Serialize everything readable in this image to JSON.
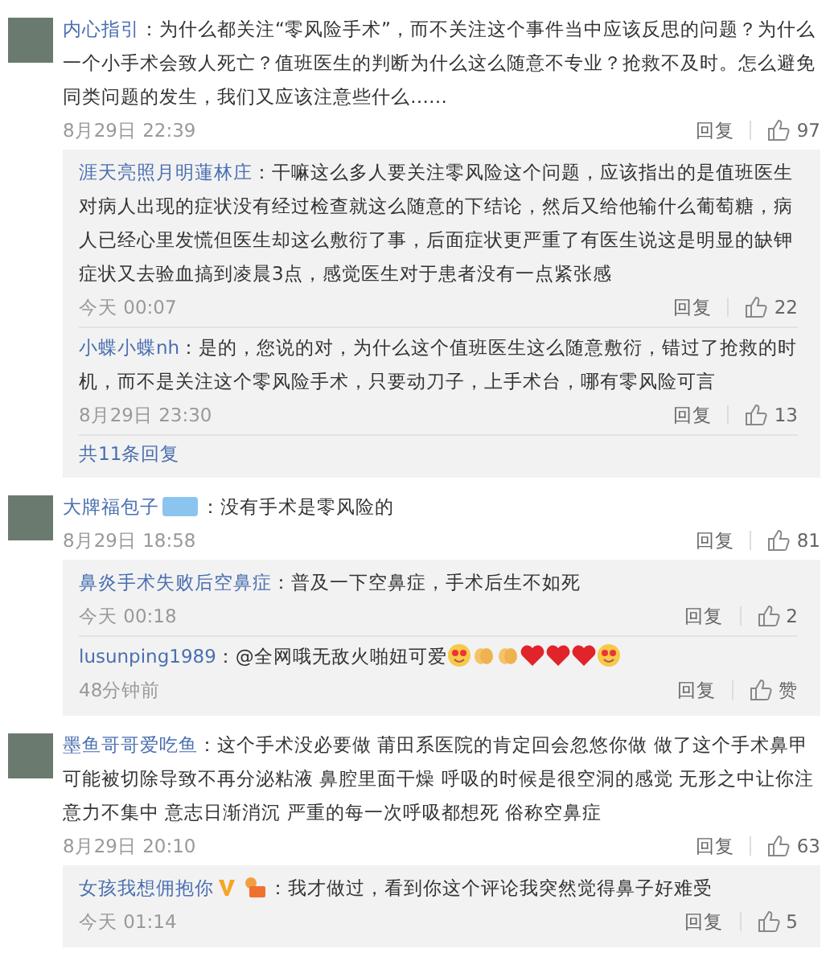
{
  "comments": [
    {
      "user": "内心指引",
      "text": "：为什么都关注“零风险手术”，而不关注这个事件当中应该反思的问题？为什么一个小手术会致人死亡？值班医生的判断为什么这么随意不专业？抢救不及时。怎么避免同类问题的发生，我们又应该注意些什么……",
      "time": "8月29日 22:39",
      "reply_label": "回复",
      "likes": "97",
      "replies": [
        {
          "user": "涯天亮照月明蓮林庄",
          "text": "：干嘛这么多人要关注零风险这个问题，应该指出的是值班医生对病人出现的症状没有经过检查就这么随意的下结论，然后又给他输什么葡萄糖，病人已经心里发慌但医生却这么敷衍了事，后面症状更严重了有医生说这是明显的缺钾症状又去验血搞到凌晨3点，感觉医生对于患者没有一点紧张感",
          "time": "今天 00:07",
          "reply_label": "回复",
          "likes": "22"
        },
        {
          "user": "小蝶小蝶nh",
          "text": "：是的，您说的对，为什么这个值班医生这么随意敷衍，错过了抢救的时机，而不是关注这个零风险手术，只要动刀子，上手术台，哪有零风险可言",
          "time": "8月29日 23:30",
          "reply_label": "回复",
          "likes": "13"
        }
      ],
      "more_replies": "共11条回复"
    },
    {
      "user": "大牌福包子",
      "badges": [
        {
          "kind": "member"
        }
      ],
      "text": "：没有手术是零风险的",
      "time": "8月29日 18:58",
      "reply_label": "回复",
      "likes": "81",
      "replies": [
        {
          "user": "鼻炎手术失败后空鼻症",
          "text": "：普及一下空鼻症，手术后生不如死",
          "time": "今天 00:18",
          "reply_label": "回复",
          "likes": "2"
        },
        {
          "user": "lusunping1989",
          "text": "：@全网哦无敌火啪妞可爱",
          "emojis": [
            {
              "kind": "face"
            },
            {
              "kind": "clap"
            },
            {
              "kind": "clap"
            },
            {
              "kind": "heart"
            },
            {
              "kind": "heart"
            },
            {
              "kind": "heart"
            },
            {
              "kind": "face"
            }
          ],
          "time": "48分钟前",
          "reply_label": "回复",
          "likes": "赞"
        }
      ]
    },
    {
      "user": "墨鱼哥哥爱吃鱼",
      "text": "：这个手术没必要做 莆田系医院的肯定回会忽悠你做 做了这个手术鼻甲可能被切除导致不再分泌粘液 鼻腔里面干燥 呼吸的时候是很空洞的感觉 无形之中让你注意力不集中 意志日渐消沉 严重的每一次呼吸都想死 俗称空鼻症",
      "time": "8月29日 20:10",
      "reply_label": "回复",
      "likes": "63",
      "replies": [
        {
          "user": "女孩我想佣抱你",
          "badges": [
            {
              "kind": "verified"
            },
            {
              "kind": "fan"
            }
          ],
          "text": "：我才做过，看到你这个评论我突然觉得鼻子好难受",
          "time": "今天 01:14",
          "reply_label": "回复",
          "likes": "5"
        }
      ]
    }
  ]
}
